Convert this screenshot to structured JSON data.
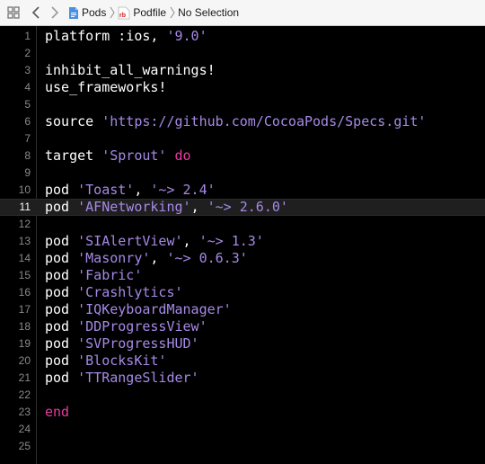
{
  "jumpbar": {
    "icons": [
      "grid-icon",
      "chevron-left-icon",
      "chevron-right-icon",
      "folder-icon",
      "ruby-file-icon"
    ],
    "breadcrumbs": [
      "Pods",
      "Podfile",
      "No Selection"
    ],
    "ruby_badge": "rb"
  },
  "editor": {
    "current_line": 11,
    "colors": {
      "background": "#000000",
      "plain": "#ffffff",
      "string": "#a58ae6",
      "keyword": "#e83aa0",
      "line_number": "#8a8a8a",
      "current_line_bg": "#1f1f1f"
    },
    "lines": [
      {
        "n": "1",
        "tokens": [
          {
            "t": "platform :ios, ",
            "k": "plain"
          },
          {
            "t": "'9.0'",
            "k": "string"
          }
        ]
      },
      {
        "n": "2",
        "tokens": []
      },
      {
        "n": "3",
        "tokens": [
          {
            "t": "inhibit_all_warnings!",
            "k": "plain"
          }
        ]
      },
      {
        "n": "4",
        "tokens": [
          {
            "t": "use_frameworks!",
            "k": "plain"
          }
        ]
      },
      {
        "n": "5",
        "tokens": []
      },
      {
        "n": "6",
        "tokens": [
          {
            "t": "source ",
            "k": "plain"
          },
          {
            "t": "'https://github.com/CocoaPods/Specs.git'",
            "k": "string"
          }
        ]
      },
      {
        "n": "7",
        "tokens": []
      },
      {
        "n": "8",
        "tokens": [
          {
            "t": "target ",
            "k": "plain"
          },
          {
            "t": "'Sprout'",
            "k": "string"
          },
          {
            "t": " ",
            "k": "plain"
          },
          {
            "t": "do",
            "k": "keyword"
          }
        ]
      },
      {
        "n": "9",
        "tokens": []
      },
      {
        "n": "10",
        "tokens": [
          {
            "t": "pod ",
            "k": "plain"
          },
          {
            "t": "'Toast'",
            "k": "string"
          },
          {
            "t": ", ",
            "k": "plain"
          },
          {
            "t": "'~> 2.4'",
            "k": "string"
          }
        ]
      },
      {
        "n": "11",
        "tokens": [
          {
            "t": "pod ",
            "k": "plain"
          },
          {
            "t": "'AFNetworking'",
            "k": "string"
          },
          {
            "t": ", ",
            "k": "plain"
          },
          {
            "t": "'~> 2.6.0'",
            "k": "string"
          }
        ]
      },
      {
        "n": "12",
        "tokens": []
      },
      {
        "n": "13",
        "tokens": [
          {
            "t": "pod ",
            "k": "plain"
          },
          {
            "t": "'SIAlertView'",
            "k": "string"
          },
          {
            "t": ", ",
            "k": "plain"
          },
          {
            "t": "'~> 1.3'",
            "k": "string"
          }
        ]
      },
      {
        "n": "14",
        "tokens": [
          {
            "t": "pod ",
            "k": "plain"
          },
          {
            "t": "'Masonry'",
            "k": "string"
          },
          {
            "t": ", ",
            "k": "plain"
          },
          {
            "t": "'~> 0.6.3'",
            "k": "string"
          }
        ]
      },
      {
        "n": "15",
        "tokens": [
          {
            "t": "pod ",
            "k": "plain"
          },
          {
            "t": "'Fabric'",
            "k": "string"
          }
        ]
      },
      {
        "n": "16",
        "tokens": [
          {
            "t": "pod ",
            "k": "plain"
          },
          {
            "t": "'Crashlytics'",
            "k": "string"
          }
        ]
      },
      {
        "n": "17",
        "tokens": [
          {
            "t": "pod ",
            "k": "plain"
          },
          {
            "t": "'IQKeyboardManager'",
            "k": "string"
          }
        ]
      },
      {
        "n": "18",
        "tokens": [
          {
            "t": "pod ",
            "k": "plain"
          },
          {
            "t": "'DDProgressView'",
            "k": "string"
          }
        ]
      },
      {
        "n": "19",
        "tokens": [
          {
            "t": "pod ",
            "k": "plain"
          },
          {
            "t": "'SVProgressHUD'",
            "k": "string"
          }
        ]
      },
      {
        "n": "20",
        "tokens": [
          {
            "t": "pod ",
            "k": "plain"
          },
          {
            "t": "'BlocksKit'",
            "k": "string"
          }
        ]
      },
      {
        "n": "21",
        "tokens": [
          {
            "t": "pod ",
            "k": "plain"
          },
          {
            "t": "'TTRangeSlider'",
            "k": "string"
          }
        ]
      },
      {
        "n": "22",
        "tokens": []
      },
      {
        "n": "23",
        "tokens": [
          {
            "t": "end",
            "k": "keyword"
          }
        ]
      },
      {
        "n": "24",
        "tokens": []
      },
      {
        "n": "25",
        "tokens": []
      }
    ]
  }
}
